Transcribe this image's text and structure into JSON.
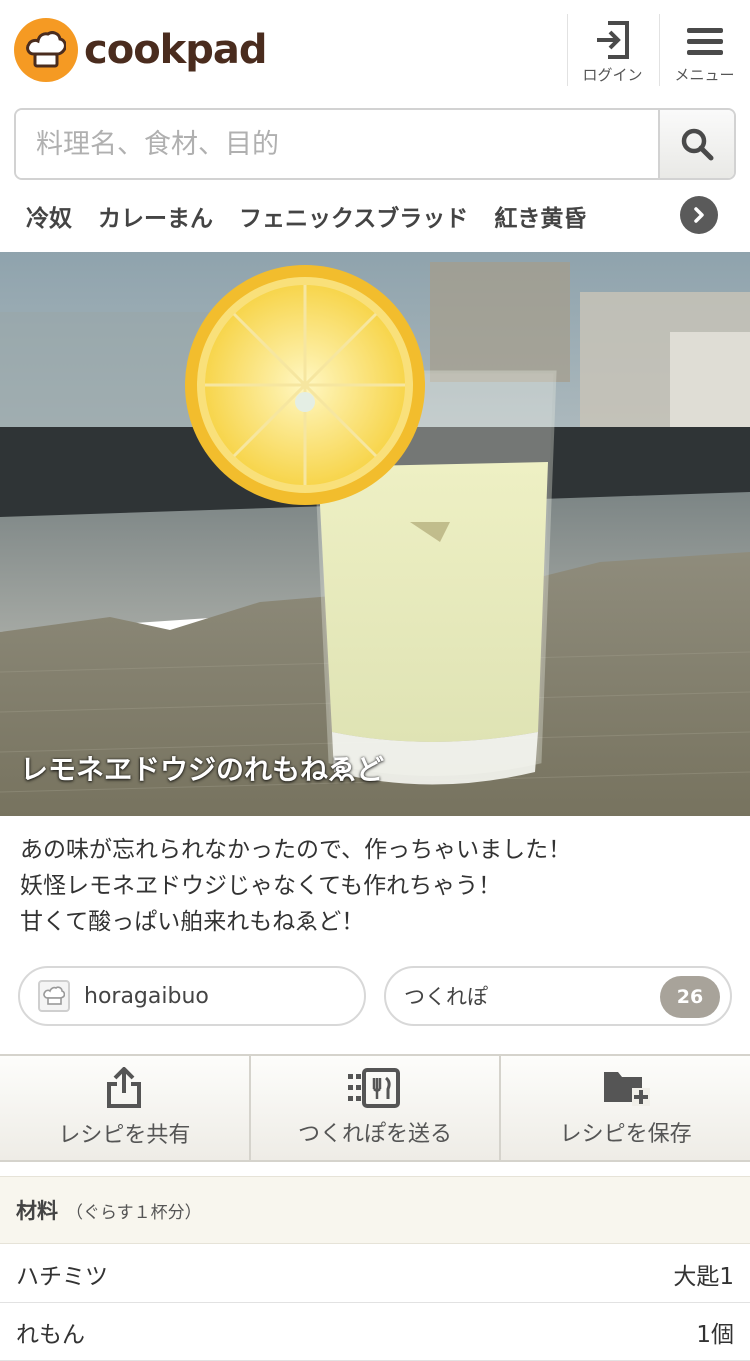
{
  "header": {
    "logo_text": "cookpad",
    "login_label": "ログイン",
    "menu_label": "メニュー"
  },
  "search": {
    "placeholder": "料理名、食材、目的",
    "value": ""
  },
  "keywords": [
    "冷奴",
    "カレーまん",
    "フェニックスブラッド",
    "紅き黄昏"
  ],
  "recipe": {
    "title": "レモネヱドウジのれもねゑど",
    "description": [
      "あの味が忘れられなかったので、作っちゃいました！",
      "妖怪レモネヱドウジじゃなくても作れちゃう！",
      "甘くて酸っぱい舶来れもねゑど！"
    ],
    "author": "horagaibuo",
    "tsukurepo_label": "つくれぽ",
    "tsukurepo_count": "26"
  },
  "actions": {
    "share": "レシピを共有",
    "send_tsukurepo": "つくれぽを送る",
    "save": "レシピを保存"
  },
  "ingredients": {
    "title": "材料",
    "serving": "（ぐらす１杯分）",
    "items": [
      {
        "name": "ハチミツ",
        "qty": "大匙1"
      },
      {
        "name": "れもん",
        "qty": "1個"
      }
    ]
  },
  "colors": {
    "brand_orange": "#f59a23",
    "brand_brown": "#4a2c1e",
    "count_badge": "#a8a39a"
  }
}
